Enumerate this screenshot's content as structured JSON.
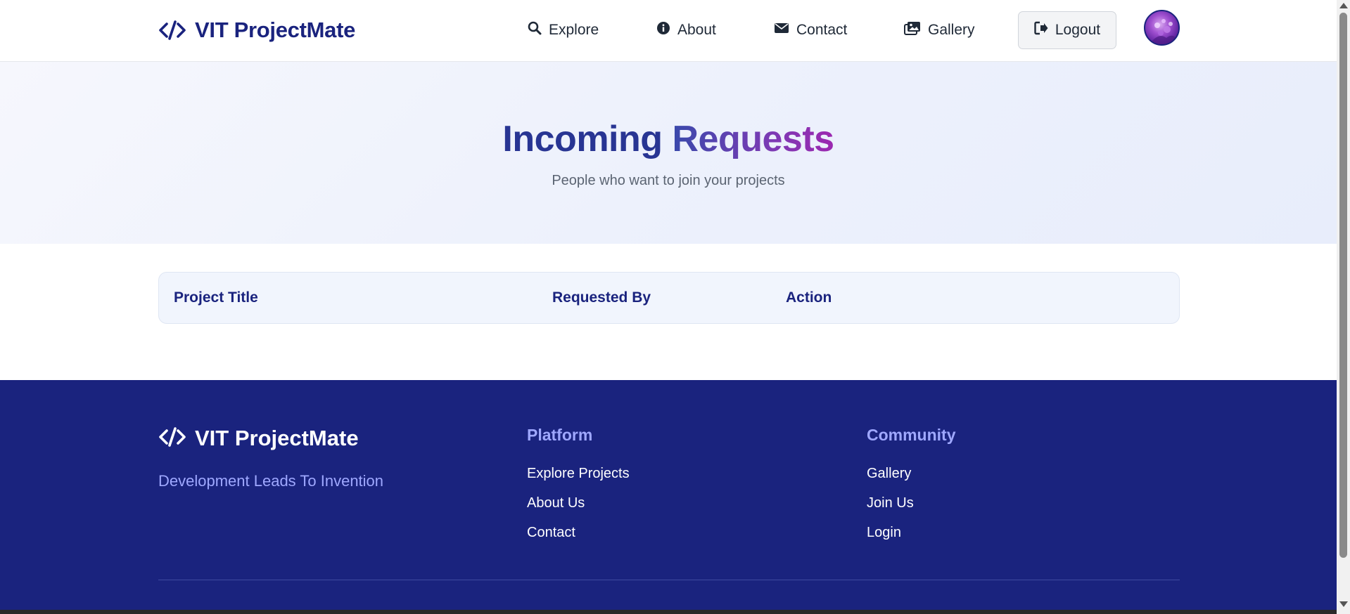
{
  "brand": {
    "name": "VIT ProjectMate",
    "icon": "code-icon"
  },
  "nav": {
    "items": [
      {
        "label": "Explore",
        "icon": "search-icon"
      },
      {
        "label": "About",
        "icon": "info-icon"
      },
      {
        "label": "Contact",
        "icon": "envelope-icon"
      },
      {
        "label": "Gallery",
        "icon": "images-icon"
      }
    ],
    "logout": {
      "label": "Logout",
      "icon": "logout-icon"
    }
  },
  "hero": {
    "title_part1": "Incoming",
    "title_part2": "Requests",
    "subtitle": "People who want to join your projects"
  },
  "table": {
    "columns": [
      "Project Title",
      "Requested By",
      "Action"
    ],
    "rows": []
  },
  "footer": {
    "brand": "VIT ProjectMate",
    "tagline": "Development Leads To Invention",
    "platform": {
      "title": "Platform",
      "links": [
        "Explore Projects",
        "About Us",
        "Contact"
      ]
    },
    "community": {
      "title": "Community",
      "links": [
        "Gallery",
        "Join Us",
        "Login"
      ]
    }
  },
  "colors": {
    "primary": "#1a237e",
    "accent": "#9c27b0",
    "footer_heading": "#9fa8ff"
  }
}
